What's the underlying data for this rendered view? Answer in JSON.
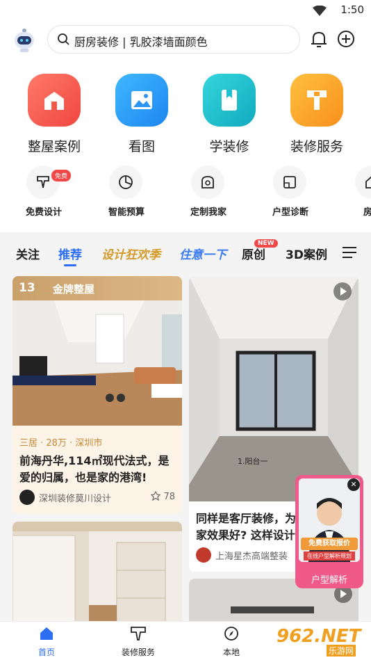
{
  "status": {
    "time": "1:50"
  },
  "search": {
    "placeholder": "厨房装修 | 乳胶漆墙面颜色"
  },
  "main_categories": [
    {
      "label": "整屋案例",
      "icon": "house-icon",
      "color": "#f5594d"
    },
    {
      "label": "看图",
      "icon": "image-icon",
      "color": "#2f9cf6"
    },
    {
      "label": "学装修",
      "icon": "book-icon",
      "color": "#1fbfcf"
    },
    {
      "label": "装修服务",
      "icon": "service-icon",
      "color": "#fba52b"
    }
  ],
  "tools": [
    {
      "label": "免费设计",
      "icon": "design-icon",
      "badge": "免费"
    },
    {
      "label": "智能预算",
      "icon": "pie-chart-icon"
    },
    {
      "label": "定制我家",
      "icon": "tape-measure-icon"
    },
    {
      "label": "户型诊断",
      "icon": "floorplan-icon"
    },
    {
      "label": "房屋",
      "icon": "house-check-icon"
    }
  ],
  "feed_tabs": [
    {
      "label": "关注"
    },
    {
      "label": "推荐"
    },
    {
      "label": "设计狂欢季"
    },
    {
      "label": "住意一下"
    },
    {
      "label": "原创",
      "badge": "NEW"
    },
    {
      "label": "3D案例"
    }
  ],
  "cards": [
    {
      "banner_num": "13",
      "banner_text": "金牌整屋",
      "meta": "三居 · 28万 · 深圳市",
      "title": "前海丹华,114㎡现代法式，是爱的归属，也是家的港湾!",
      "author": "深圳装修莫川设计",
      "likes": "78"
    },
    {
      "photo_caption": "1.阳台一",
      "title": "同样是客厅装修，为家效果好? 这样设计",
      "author": "上海星杰高端整装"
    }
  ],
  "float_ad": {
    "promo": "免费获取报价",
    "promo_sub": "在线户型解析规划",
    "label": "户型解析"
  },
  "bottom_nav": [
    {
      "label": "首页"
    },
    {
      "label": "装修服务"
    },
    {
      "label": "本地"
    }
  ],
  "watermark": {
    "text": "962.NET",
    "sub": "乐游网"
  },
  "colors": {
    "accent": "#2d6ef5",
    "gold": "#c9a06a",
    "badge_red": "#f04848"
  }
}
